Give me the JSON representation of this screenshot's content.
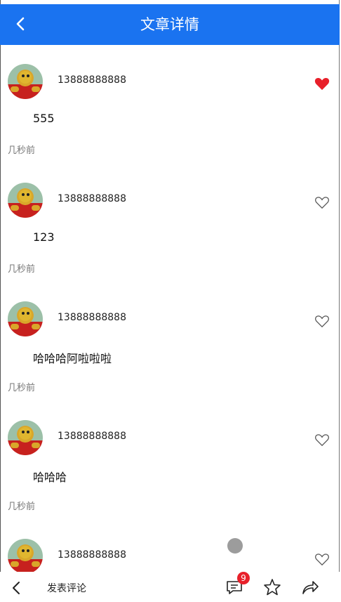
{
  "header": {
    "title": "文章详情"
  },
  "comments": [
    {
      "user": "13888888888",
      "content": "555",
      "time": "几秒前",
      "liked": true
    },
    {
      "user": "13888888888",
      "content": "123",
      "time": "几秒前",
      "liked": false
    },
    {
      "user": "13888888888",
      "content": "哈哈哈阿啦啦啦",
      "time": "几秒前",
      "liked": false
    },
    {
      "user": "13888888888",
      "content": "哈哈哈",
      "time": "几秒前",
      "liked": false
    },
    {
      "user": "13888888888",
      "content": "",
      "time": "",
      "liked": false
    }
  ],
  "bottom_bar": {
    "post_label": "发表评论",
    "comment_count": "9"
  },
  "colors": {
    "header": "#1a73f0",
    "liked_heart": "#e8202a",
    "badge": "#e8202a"
  }
}
